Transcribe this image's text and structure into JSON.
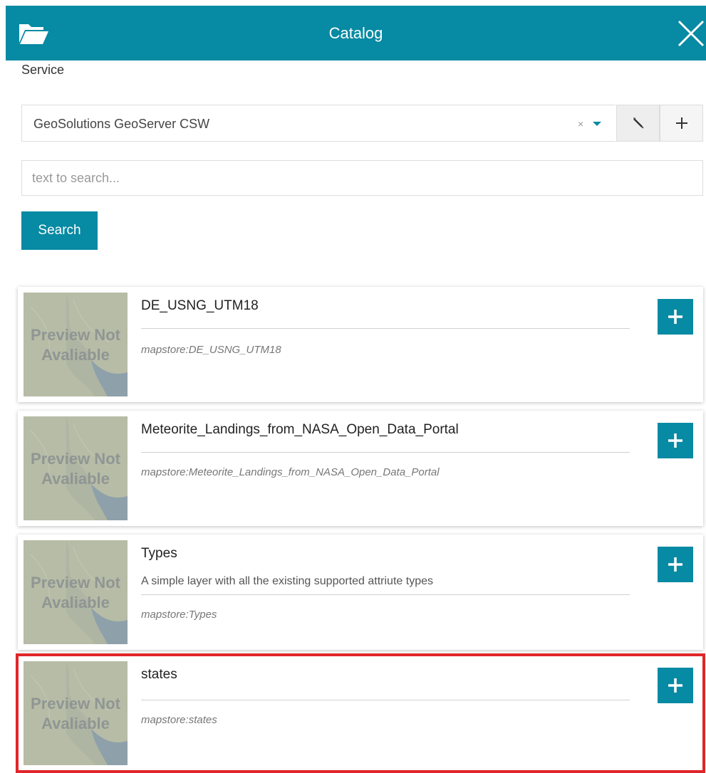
{
  "header": {
    "title": "Catalog",
    "folder_icon": "folder-open-icon",
    "close_icon": "close-icon",
    "bg_color": "#078aa3"
  },
  "service": {
    "label": "Service",
    "selected": "GeoSolutions GeoServer CSW",
    "clear_glyph": "×",
    "edit_icon": "pencil-icon",
    "add_icon": "plus-icon"
  },
  "search": {
    "placeholder": "text to search...",
    "button_label": "Search"
  },
  "records": [
    {
      "name": "DE_USNG_UTM18",
      "description": "",
      "ref": "mapstore:DE_USNG_UTM18",
      "preview": "Preview Not Avaliable"
    },
    {
      "name": "Meteorite_Landings_from_NASA_Open_Data_Portal",
      "description": "",
      "ref": "mapstore:Meteorite_Landings_from_NASA_Open_Data_Portal",
      "preview": "Preview Not Avaliable"
    },
    {
      "name": "Types",
      "description": "A simple layer with all the existing supported attriute types",
      "ref": "mapstore:Types",
      "preview": "Preview Not Avaliable"
    },
    {
      "name": "states",
      "description": "",
      "ref": "mapstore:states",
      "preview": "Preview Not Avaliable",
      "highlighted": true
    }
  ]
}
